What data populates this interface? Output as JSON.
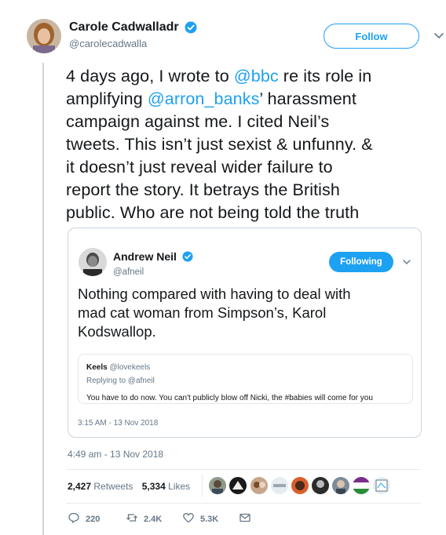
{
  "author": {
    "name": "Carole Cadwalladr",
    "handle": "@carolecadwalla",
    "follow_label": "Follow"
  },
  "tweet": {
    "line1_pre": "4 days ago, I wrote to ",
    "mention1": "@bbc",
    "line1_post": " re its role in",
    "line2_pre": "amplifying ",
    "mention2": "@arron_banks",
    "line2_post": "’ harassment",
    "line3": "campaign against me. I cited Neil’s",
    "line4": "tweets. This isn’t just sexist & unfunny. &",
    "line5": "it doesn’t just reveal wider failure to",
    "line6": "report the story. It betrays the British",
    "line7": "public. Who are not being told the truth",
    "timestamp": "4:49 am - 13 Nov 2018"
  },
  "quoted": {
    "name": "Andrew Neil",
    "handle": "@afneil",
    "following_label": "Following",
    "line1": "Nothing compared with having to deal with",
    "line2": "mad cat woman from Simpson’s, Karol",
    "line3": "Kodswallop.",
    "time": "3:15 AM - 13 Nov 2018",
    "inner": {
      "author": "Keels",
      "handle": "@lovekeels",
      "replying": "Replying to @afneil",
      "text": "You have to do now. You can't publicly blow off Nicki, the #babies will come for you"
    }
  },
  "stats": {
    "retweets_count": "2,427",
    "retweets_label": "Retweets",
    "likes_count": "5,334",
    "likes_label": "Likes"
  },
  "actions": {
    "replies": "220",
    "retweets": "2.4K",
    "likes": "5.3K"
  },
  "colors": {
    "accent": "#1da1f2",
    "muted": "#657786",
    "border": "#ccd6dd"
  }
}
